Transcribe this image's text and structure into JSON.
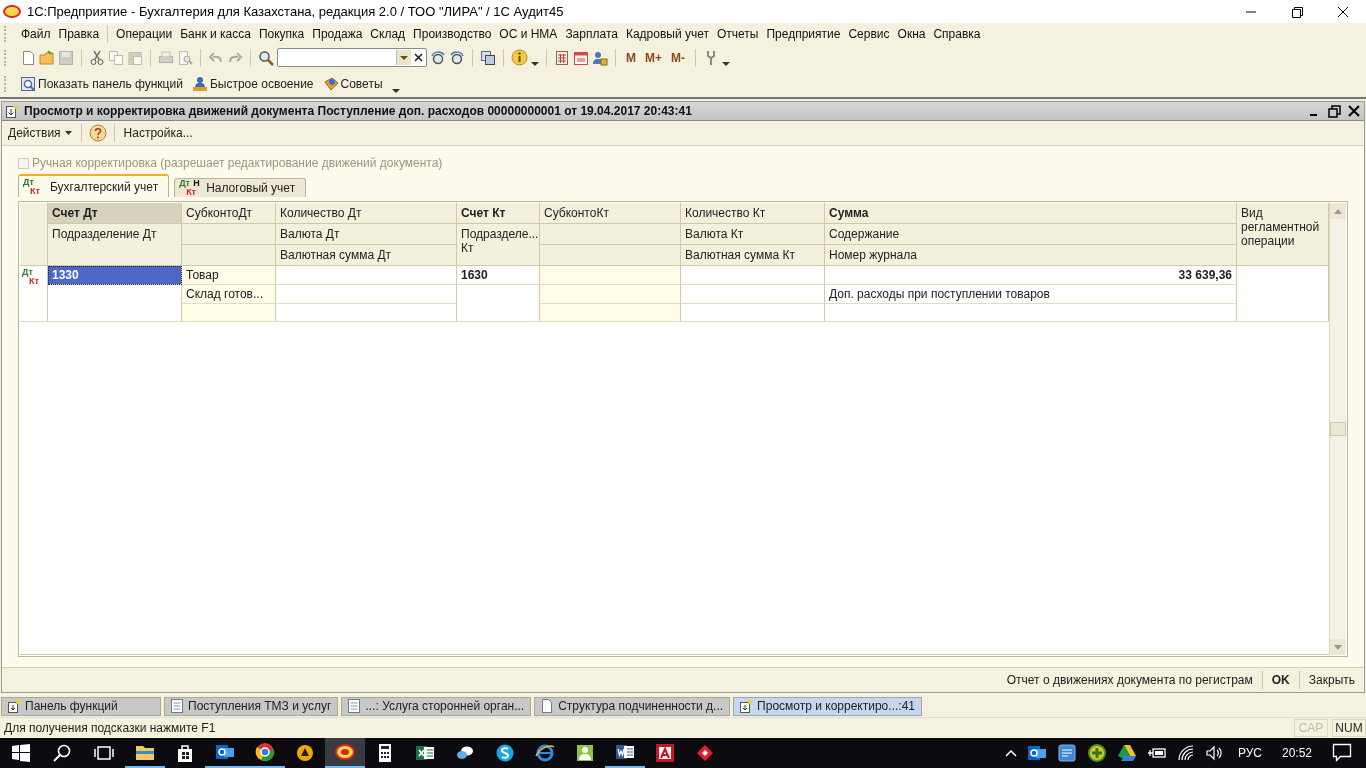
{
  "window": {
    "title": "1С:Предприятие - Бухгалтерия для Казахстана, редакция 2.0 / ТОО \"ЛИРА\" / 1С Аудит45"
  },
  "menu": [
    "Файл",
    "Правка",
    "Операции",
    "Банк и касса",
    "Покупка",
    "Продажа",
    "Склад",
    "Производство",
    "ОС и НМА",
    "Зарплата",
    "Кадровый учет",
    "Отчеты",
    "Предприятие",
    "Сервис",
    "Окна",
    "Справка"
  ],
  "toolbar": {
    "memory_buttons": [
      "M",
      "M+",
      "M-"
    ]
  },
  "toolbar2": [
    "Показать панель функций",
    "Быстрое освоение",
    "Советы"
  ],
  "document": {
    "title": "Просмотр и корректировка движений документа Поступление доп. расходов 00000000001 от 19.04.2017 20:43:41",
    "actions": [
      "Действия",
      "Настройка..."
    ],
    "manual_edit": {
      "label": "Ручная корректировка (разрешает редактирование движений документа)",
      "checked": false,
      "disabled": true
    },
    "tabs": [
      {
        "label": "Бухгалтерский учет",
        "badge": [
          "Дт",
          "Кт"
        ],
        "selected": true
      },
      {
        "label": "Налоговый учет",
        "badge": [
          "Дт",
          "Н",
          "Кт"
        ],
        "selected": false
      }
    ],
    "table": {
      "columns": [
        {
          "kind": "split",
          "primary": true,
          "sorted": true,
          "header": [
            "Счет Дт",
            "Подразделение Дт"
          ]
        },
        {
          "kind": "single",
          "primary": false,
          "sorted": false,
          "header": [
            "СубконтоДт"
          ]
        },
        {
          "kind": "stack",
          "primary": false,
          "sorted": false,
          "header": [
            "Количество Дт",
            "Валюта Дт",
            "Валютная сумма Дт"
          ]
        },
        {
          "kind": "split",
          "primary": true,
          "sorted": false,
          "header": [
            "Счет Кт",
            "Подразделе... Кт"
          ]
        },
        {
          "kind": "single",
          "primary": false,
          "sorted": false,
          "header": [
            "СубконтоКт"
          ]
        },
        {
          "kind": "stack",
          "primary": false,
          "sorted": false,
          "header": [
            "Количество Кт",
            "Валюта Кт",
            "Валютная сумма Кт"
          ]
        },
        {
          "kind": "stack",
          "primary": true,
          "sorted": false,
          "header": [
            "Сумма",
            "Содержание",
            "Номер журнала"
          ]
        },
        {
          "kind": "tall",
          "primary": false,
          "sorted": false,
          "header": [
            "Вид регламентной операции"
          ]
        }
      ],
      "rows": [
        {
          "marker": [
            "Дт",
            "Кт"
          ],
          "cells": [
            [
              {
                "text": "1330",
                "numeric": false,
                "selected": true
              }
            ],
            [
              {
                "text": "Товар",
                "numeric": false,
                "selected": false
              },
              {
                "text": "Склад готов...",
                "numeric": false,
                "selected": false
              }
            ],
            null,
            [
              {
                "text": "1630",
                "numeric": false,
                "selected": false
              }
            ],
            null,
            null,
            [
              {
                "text": "33 639,36",
                "numeric": true,
                "selected": false
              },
              {
                "text": "Доп. расходы при поступлении товаров",
                "numeric": false,
                "selected": false
              }
            ],
            null
          ]
        }
      ]
    },
    "footer": [
      {
        "label": "Отчет о движениях документа по регистрам",
        "kind": "link"
      },
      {
        "label": "OK",
        "kind": "default"
      },
      {
        "label": "Закрыть",
        "kind": "link"
      }
    ]
  },
  "window_tabs": [
    {
      "label": "Панель функций",
      "selected": false
    },
    {
      "label": "Поступления ТМЗ и услуг",
      "selected": false
    },
    {
      "label": "...: Услуга сторонней орган...",
      "selected": false
    },
    {
      "label": "Структура подчиненности д...",
      "selected": false
    },
    {
      "label": "Просмотр и корректиро...:41",
      "selected": true
    }
  ],
  "status_bar": {
    "hint": "Для получения подсказки нажмите F1",
    "indicators": [
      {
        "label": "CAP",
        "on": false
      },
      {
        "label": "NUM",
        "on": true
      }
    ]
  },
  "taskbar": {
    "apps": [
      {
        "running": true,
        "active": false
      },
      {
        "running": false,
        "active": false
      },
      {
        "running": true,
        "active": false
      },
      {
        "running": true,
        "active": false
      },
      {
        "running": false,
        "active": false
      },
      {
        "running": true,
        "active": true
      },
      {
        "running": false,
        "active": false
      },
      {
        "running": false,
        "active": false
      },
      {
        "running": false,
        "active": false
      },
      {
        "running": false,
        "active": false
      },
      {
        "running": false,
        "active": false
      },
      {
        "running": false,
        "active": false
      },
      {
        "running": true,
        "active": false
      },
      {
        "running": false,
        "active": false
      },
      {
        "running": false,
        "active": false
      }
    ],
    "language": "РУС",
    "time": "20:52"
  }
}
